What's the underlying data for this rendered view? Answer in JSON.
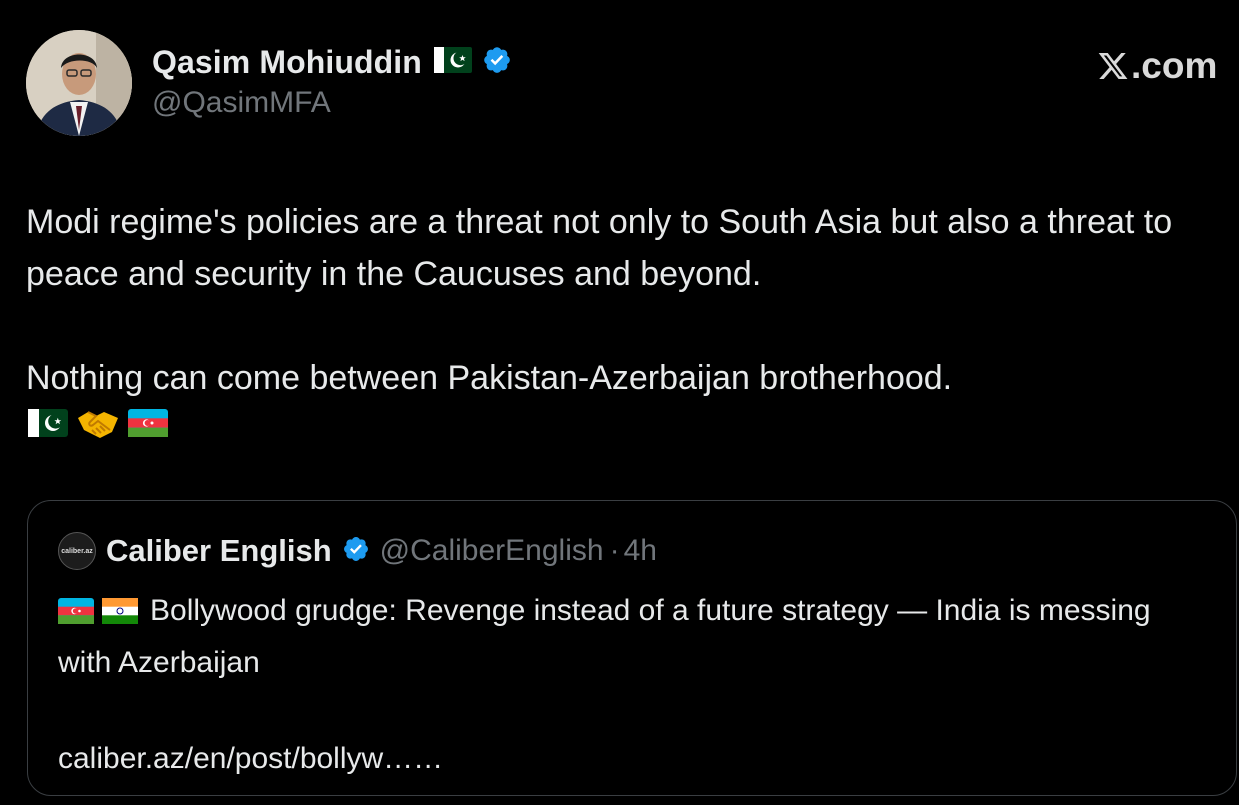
{
  "brand": {
    "text": ".com"
  },
  "author": {
    "display_name": "Qasim Mohiuddin",
    "handle": "@QasimMFA"
  },
  "tweet": {
    "paragraph_1": "Modi regime's policies are a threat not only to South Asia but also a threat to peace and security in the Caucuses and beyond.",
    "paragraph_2": "Nothing can come between Pakistan-Azerbaijan brotherhood.",
    "emojis": [
      "pakistan-flag",
      "handshake",
      "azerbaijan-flag"
    ]
  },
  "quote": {
    "avatar_text": "caliber.az",
    "display_name": "Caliber English",
    "handle": "@CaliberEnglish",
    "separator": "·",
    "time": "4h",
    "flags": [
      "azerbaijan-flag",
      "india-flag"
    ],
    "text": "Bollywood grudge: Revenge instead of a future strategy — India is messing with Azerbaijan",
    "link": "caliber.az/en/post/bollyw……"
  },
  "colors": {
    "background": "#000000",
    "text_primary": "#e7e9ea",
    "text_secondary": "#71767b",
    "verified_blue": "#1d9bf0",
    "card_border": "#3a3e42"
  }
}
